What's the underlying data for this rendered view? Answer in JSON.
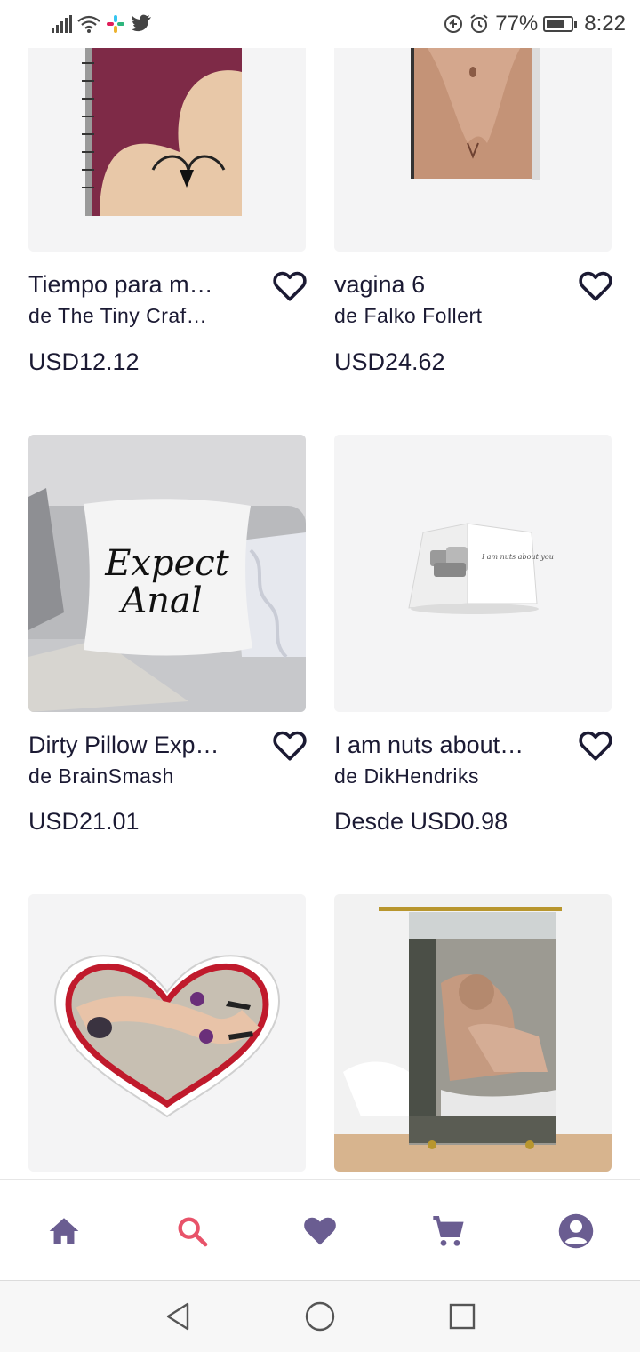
{
  "status_bar": {
    "battery": "77%",
    "time": "8:22",
    "battery_level": 0.77
  },
  "products": [
    {
      "title": "Tiempo para m…",
      "artist": "de The Tiny  Craf…",
      "price": "USD12.12"
    },
    {
      "title": "vagina 6",
      "artist": "de Falko Follert",
      "price": "USD24.62"
    },
    {
      "title": "Dirty Pillow Exp…",
      "artist": "de BrainSmash",
      "price": "USD21.01"
    },
    {
      "title": "I am nuts about…",
      "artist": "de DikHendriks",
      "price": "Desde USD0.98"
    },
    {
      "title": "",
      "artist": "",
      "price": ""
    },
    {
      "title": "",
      "artist": "",
      "price": ""
    }
  ],
  "pillow_text": "Expect Anal",
  "card_text": "I am nuts about you",
  "bottom_nav": {
    "items": [
      "home-icon",
      "search-icon",
      "favorites-icon",
      "cart-icon",
      "account-icon"
    ],
    "active": "search-icon"
  },
  "colors": {
    "accent": "#e8536a",
    "nav_icon": "#6a5d91",
    "text": "#1b1a33",
    "thumb_bg": "#f4f4f5"
  }
}
